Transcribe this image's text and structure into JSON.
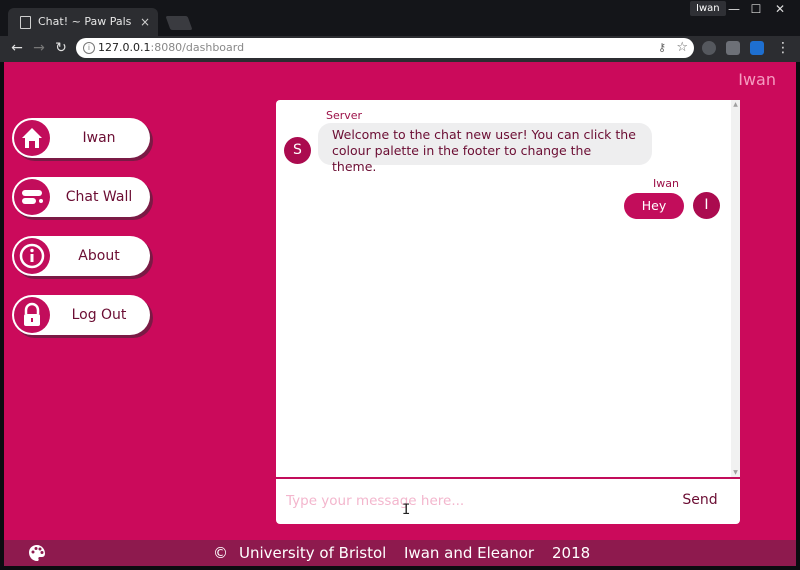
{
  "browser": {
    "tab_title": "Chat! ~ Paw Pals",
    "tab_close": "×",
    "profile_name": "Iwan",
    "url_host": "127.0.0.1",
    "url_path": ":8080/dashboard",
    "window_controls": {
      "minimize": "—",
      "maximize": "☐",
      "close": "✕"
    }
  },
  "header": {
    "username": "Iwan"
  },
  "sidebar": {
    "items": [
      {
        "label": "Iwan",
        "icon": "home-icon"
      },
      {
        "label": "Chat Wall",
        "icon": "chat-icon"
      },
      {
        "label": "About",
        "icon": "info-icon"
      },
      {
        "label": "Log Out",
        "icon": "lock-icon"
      }
    ]
  },
  "chat": {
    "messages": [
      {
        "sender": "Server",
        "avatar_letter": "S",
        "line1": "Welcome to the chat new user! You can click the",
        "line2": "colour palette in the footer to change the theme."
      },
      {
        "sender": "Iwan",
        "avatar_letter": "I",
        "text": "Hey"
      }
    ],
    "input_placeholder": "Type your message here...",
    "input_value": "",
    "send_label": "Send"
  },
  "footer": {
    "copyright": "©",
    "university": "University of Bristol",
    "authors": "Iwan and Eleanor",
    "year": "2018"
  },
  "colors": {
    "theme": "#cb0a5b",
    "footer": "#8e1a4e",
    "accent_text": "#6b0d33",
    "avatar": "#ab0b4f"
  }
}
